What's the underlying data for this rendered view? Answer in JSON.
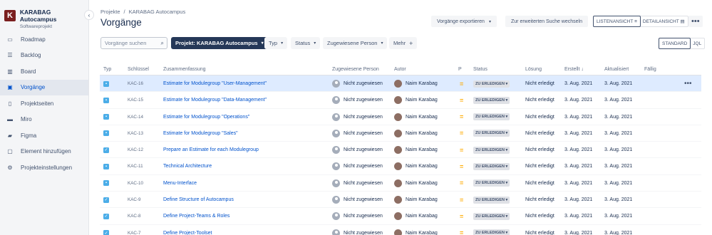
{
  "project": {
    "logo_letter": "K",
    "name": "KARABAG Autocampus",
    "type": "Softwareprojekt"
  },
  "sidebar": {
    "collapse_icon": "chevron-left-icon",
    "items": [
      {
        "label": "Roadmap",
        "icon": "roadmap-icon",
        "active": false
      },
      {
        "label": "Backlog",
        "icon": "backlog-icon",
        "active": false
      },
      {
        "label": "Board",
        "icon": "board-icon",
        "active": false
      },
      {
        "label": "Vorgänge",
        "icon": "issues-icon",
        "active": true
      },
      {
        "label": "Projektseiten",
        "icon": "pages-icon",
        "active": false
      },
      {
        "label": "Miro",
        "icon": "miro-icon",
        "active": false
      },
      {
        "label": "Figma",
        "icon": "figma-icon",
        "active": false
      },
      {
        "label": "Element hinzufügen",
        "icon": "add-item-icon",
        "active": false
      },
      {
        "label": "Projekteinstellungen",
        "icon": "gear-icon",
        "active": false
      }
    ]
  },
  "header": {
    "breadcrumb": [
      "Projekte",
      "KARABAG Autocampus"
    ],
    "title": "Vorgänge",
    "export_label": "Vorgänge exportieren",
    "advanced_search_label": "Zur erweiterten Suche wechseln",
    "list_view_label": "LISTENANSICHT",
    "detail_view_label": "DETAILANSICHT",
    "standard_label": "STANDARD",
    "jql_label": "JQL"
  },
  "filters": {
    "search_placeholder": "Vorgänge suchen",
    "project_label": "Projekt: KARABAG Autocampus",
    "type_label": "Typ",
    "status_label": "Status",
    "assignee_label": "Zugewiesene Person",
    "more_label": "Mehr"
  },
  "table": {
    "columns": [
      "Typ",
      "Schlüssel",
      "Zusammenfassung",
      "Zugewiesene Person",
      "Autor",
      "P",
      "Status",
      "Lösung",
      "Erstellt",
      "Aktualisiert",
      "Fällig"
    ],
    "sort_indicator": "↓",
    "rows": [
      {
        "type": "task",
        "key": "KAC-16",
        "summary": "Estimate for Modulegroup \"User-Management\"",
        "assignee": "Nicht zugewiesen",
        "author": "Naim Karabag",
        "priority": "=",
        "status": "ZU ERLEDIGEN",
        "resolution": "Nicht erledigt",
        "created": "3. Aug. 2021",
        "updated": "3. Aug. 2021"
      },
      {
        "type": "task",
        "key": "KAC-15",
        "summary": "Estimate for Modulegroup \"Data-Management\"",
        "assignee": "Nicht zugewiesen",
        "author": "Naim Karabag",
        "priority": "=",
        "status": "ZU ERLEDIGEN",
        "resolution": "Nicht erledigt",
        "created": "3. Aug. 2021",
        "updated": "3. Aug. 2021"
      },
      {
        "type": "task",
        "key": "KAC-14",
        "summary": "Estimate for Modulegroup \"Operations\"",
        "assignee": "Nicht zugewiesen",
        "author": "Naim Karabag",
        "priority": "=",
        "status": "ZU ERLEDIGEN",
        "resolution": "Nicht erledigt",
        "created": "3. Aug. 2021",
        "updated": "3. Aug. 2021"
      },
      {
        "type": "task",
        "key": "KAC-13",
        "summary": "Estimate for Modulegroup \"Sales\"",
        "assignee": "Nicht zugewiesen",
        "author": "Naim Karabag",
        "priority": "=",
        "status": "ZU ERLEDIGEN",
        "resolution": "Nicht erledigt",
        "created": "3. Aug. 2021",
        "updated": "3. Aug. 2021"
      },
      {
        "type": "check",
        "key": "KAC-12",
        "summary": "Prepare an Estimate for each Modulegroup",
        "assignee": "Nicht zugewiesen",
        "author": "Naim Karabag",
        "priority": "=",
        "status": "ZU ERLEDIGEN",
        "resolution": "Nicht erledigt",
        "created": "3. Aug. 2021",
        "updated": "3. Aug. 2021"
      },
      {
        "type": "task",
        "key": "KAC-11",
        "summary": "Technical Architecture",
        "assignee": "Nicht zugewiesen",
        "author": "Naim Karabag",
        "priority": "=",
        "status": "ZU ERLEDIGEN",
        "resolution": "Nicht erledigt",
        "created": "3. Aug. 2021",
        "updated": "3. Aug. 2021"
      },
      {
        "type": "task",
        "key": "KAC-10",
        "summary": "Menu-Interface",
        "assignee": "Nicht zugewiesen",
        "author": "Naim Karabag",
        "priority": "=",
        "status": "ZU ERLEDIGEN",
        "resolution": "Nicht erledigt",
        "created": "3. Aug. 2021",
        "updated": "3. Aug. 2021"
      },
      {
        "type": "check",
        "key": "KAC-9",
        "summary": "Define Structure of Autocampus",
        "assignee": "Nicht zugewiesen",
        "author": "Naim Karabag",
        "priority": "=",
        "status": "ZU ERLEDIGEN",
        "resolution": "Nicht erledigt",
        "created": "3. Aug. 2021",
        "updated": "3. Aug. 2021"
      },
      {
        "type": "check",
        "key": "KAC-8",
        "summary": "Define Project-Teams & Roles",
        "assignee": "Nicht zugewiesen",
        "author": "Naim Karabag",
        "priority": "=",
        "status": "ZU ERLEDIGEN",
        "resolution": "Nicht erledigt",
        "created": "3. Aug. 2021",
        "updated": "3. Aug. 2021"
      },
      {
        "type": "check",
        "key": "KAC-7",
        "summary": "Define Project-Toolset",
        "assignee": "Nicht zugewiesen",
        "author": "Naim Karabag",
        "priority": "=",
        "status": "ZU ERLEDIGEN",
        "resolution": "Nicht erledigt",
        "created": "3. Aug. 2021",
        "updated": "3. Aug. 2021"
      }
    ]
  },
  "colors": {
    "accent": "#0052cc",
    "task_icon": "#4bade8",
    "check_icon": "#4bade8",
    "priority_medium": "#ffab00",
    "selected_row": "#deebff"
  }
}
